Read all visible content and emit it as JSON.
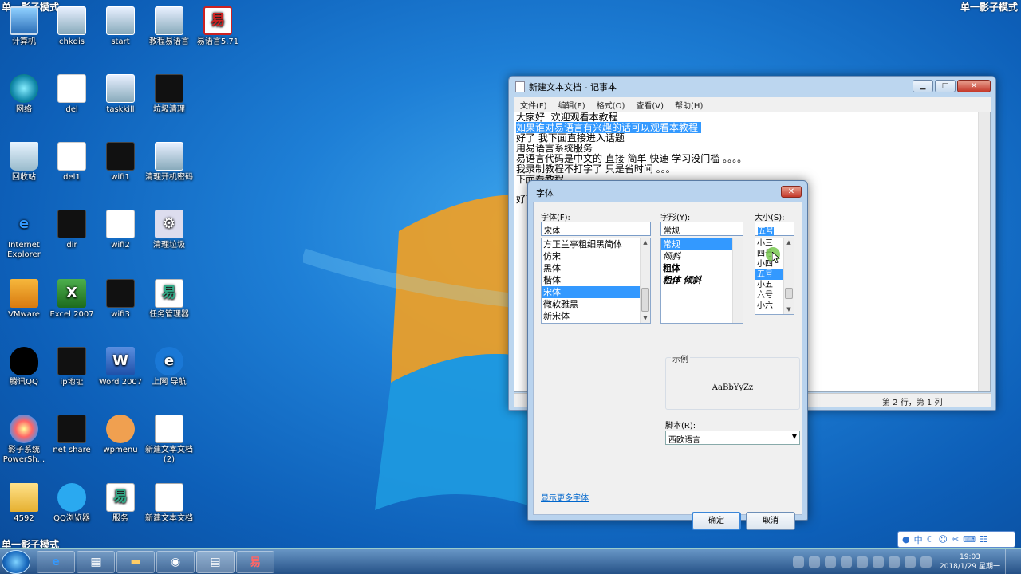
{
  "watermark": {
    "text": "单一影子模式"
  },
  "desktop": {
    "icons": [
      {
        "label": "计算机"
      },
      {
        "label": "chkdis"
      },
      {
        "label": "start"
      },
      {
        "label": "教程易语言"
      },
      {
        "label": "易语言5.71"
      },
      {
        "label": "网络"
      },
      {
        "label": "del"
      },
      {
        "label": "taskkill"
      },
      {
        "label": "垃圾清理"
      },
      {
        "label": "回收站"
      },
      {
        "label": "del1"
      },
      {
        "label": "wifi1"
      },
      {
        "label": "清理开机密码"
      },
      {
        "label": "Internet Explorer"
      },
      {
        "label": "dir"
      },
      {
        "label": "wifi2"
      },
      {
        "label": "清理垃圾"
      },
      {
        "label": "VMware"
      },
      {
        "label": "Excel 2007"
      },
      {
        "label": "wifi3"
      },
      {
        "label": "任务管理器"
      },
      {
        "label": "腾讯QQ"
      },
      {
        "label": "ip地址"
      },
      {
        "label": "Word 2007"
      },
      {
        "label": "上网 导航"
      },
      {
        "label": "影子系统 PowerSh..."
      },
      {
        "label": "net share"
      },
      {
        "label": "wpmenu"
      },
      {
        "label": "新建文本文档 (2)"
      },
      {
        "label": "4592"
      },
      {
        "label": "QQ浏览器"
      },
      {
        "label": "服务"
      },
      {
        "label": "新建文本文档"
      }
    ]
  },
  "notepad": {
    "title": "新建文本文档 - 记事本",
    "menu": [
      "文件(F)",
      "编辑(E)",
      "格式(O)",
      "查看(V)",
      "帮助(H)"
    ],
    "lines": {
      "l1": "大家好  欢迎观看本教程",
      "l2": "如果谁对易语言有兴趣的话可以观看本教程 ",
      "l3": "好了 我下面直接进入话题",
      "l4": "用易语言系统服务",
      "l5": "易语言代码是中文的 直接 简单 快速 学习没门槛 。。。。",
      "l6": "我录制教程不打字了 只是省时间 。。。",
      "l7": "下面看教程",
      "l8": "好了"
    },
    "status": "第 2 行，第 1 列"
  },
  "font_dialog": {
    "title": "字体",
    "font_label": "字体(F):",
    "font_value": "宋体",
    "font_list": [
      "方正兰亭粗细黑简体",
      "仿宋",
      "黑体",
      "楷体",
      "宋体",
      "微软雅黑",
      "新宋体"
    ],
    "font_selected": "宋体",
    "style_label": "字形(Y):",
    "style_value": "常规",
    "style_list": [
      "常规",
      "倾斜",
      "粗体",
      "粗体 倾斜"
    ],
    "size_label": "大小(S):",
    "size_value": "五号",
    "size_list": [
      "小三",
      "四号",
      "小四",
      "五号",
      "小五",
      "六号",
      "小六"
    ],
    "sample_label": "示例",
    "sample_text": "AaBbYyZz",
    "script_label": "脚本(R):",
    "script_value": "西欧语言",
    "more_fonts_link": "显示更多字体",
    "ok_label": "确定",
    "cancel_label": "取消"
  },
  "taskbar": {
    "clock_time": "19:03",
    "clock_date": "2018/1/29 星期一"
  },
  "ime_bar": {
    "lang": "中"
  }
}
